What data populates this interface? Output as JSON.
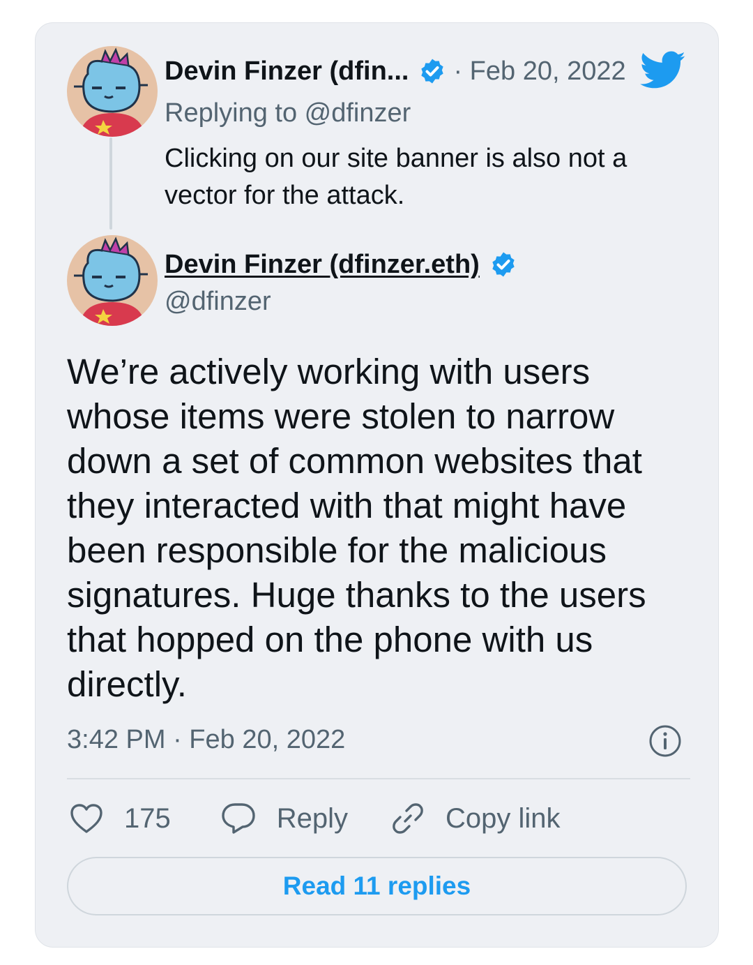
{
  "card": {
    "brand_icon": "twitter-bird-icon",
    "accent_color": "#1d9bf0"
  },
  "reply_tweet": {
    "author_name": "Devin Finzer (dfin...",
    "verified_icon": "verified-badge-icon",
    "date": "· Feb 20, 2022",
    "replying_to": "Replying to @dfinzer",
    "text": "Clicking on our site banner is also not a vector for the attack."
  },
  "main_tweet": {
    "author_name": "Devin Finzer (dfinzer.eth)",
    "handle": "@dfinzer",
    "text": "We’re actively working with users whose items were stolen to narrow down a set of common websites that they interacted with that might have been responsible for the malicious signatures. Huge thanks to the users that hopped on the phone with us directly.",
    "timestamp": "3:42 PM · Feb 20, 2022"
  },
  "actions": {
    "like_count": "175",
    "reply_label": "Reply",
    "copy_link_label": "Copy link"
  },
  "read_replies_label": "Read 11 replies"
}
